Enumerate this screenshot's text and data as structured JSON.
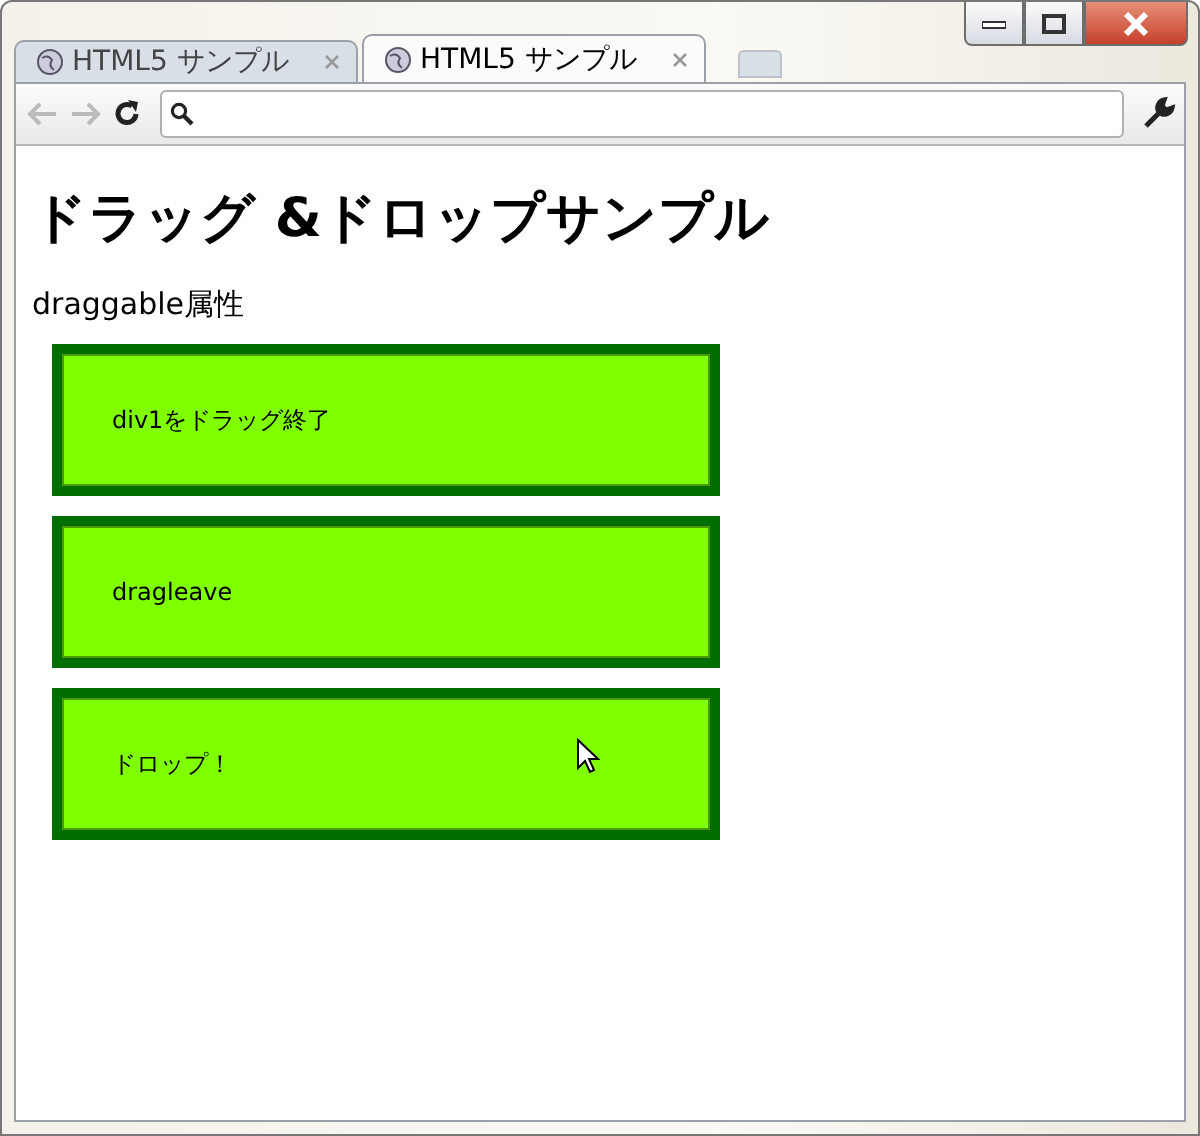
{
  "tabs": [
    {
      "label": "HTML5 サンプル",
      "selected": false
    },
    {
      "label": "HTML5 サンプル",
      "selected": true
    }
  ],
  "page": {
    "heading": "ドラッグ &ドロップサンプル",
    "subheading": "draggable属性",
    "boxes": [
      {
        "text": "div1をドラッグ終了"
      },
      {
        "text": "dragleave"
      },
      {
        "text": "ドロップ！"
      }
    ]
  }
}
